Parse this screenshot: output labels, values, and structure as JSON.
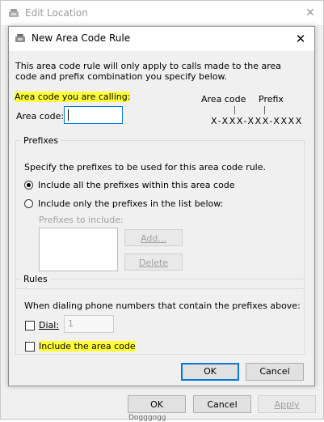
{
  "outer_window": {
    "title": "Edit Location",
    "buttons": {
      "ok": "OK",
      "cancel": "Cancel",
      "apply": "Apply"
    },
    "peek_text": "Dogggogg"
  },
  "dialog": {
    "title": "New Area Code Rule",
    "intro": "This area code rule will only apply to calls made to the area code and prefix combination you specify below.",
    "area_code_calling_heading": "Area code you are calling:",
    "area_code_label": "Area code:",
    "area_code_value": "",
    "diagram": {
      "area_code_label": "Area code",
      "prefix_label": "Prefix",
      "pattern": "X-XXX-XXX-XXXX"
    },
    "prefixes": {
      "legend": "Prefixes",
      "description": "Specify the prefixes to be used for this area code rule.",
      "option_all": "Include all the prefixes within this area code",
      "option_list": "Include only the prefixes in the list below:",
      "selected_option": "all",
      "prefixes_to_include_label": "Prefixes to include:",
      "add_button": "Add...",
      "delete_button": "Delete"
    },
    "rules": {
      "legend": "Rules",
      "description": "When dialing phone numbers that contain the prefixes above:",
      "dial_label": "Dial:",
      "dial_value": "1",
      "dial_checked": false,
      "include_area_code_label": "Include the area code",
      "include_area_code_checked": false
    },
    "buttons": {
      "ok": "OK",
      "cancel": "Cancel"
    }
  },
  "colors": {
    "highlight": "#ffff39",
    "focus_border": "#0078d7"
  }
}
